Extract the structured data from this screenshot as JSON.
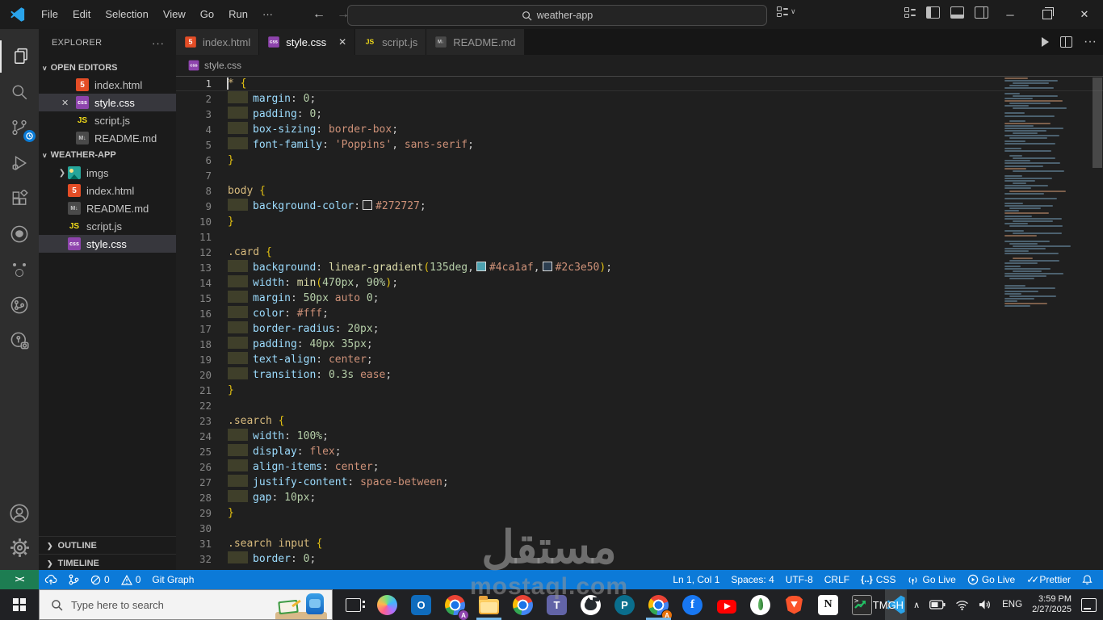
{
  "titlebar": {
    "menus": [
      "File",
      "Edit",
      "Selection",
      "View",
      "Go",
      "Run",
      "···"
    ],
    "search_value": "weather-app",
    "window": {
      "minimize": "─",
      "close": "✕"
    }
  },
  "activitybar": {
    "icons": [
      "explorer",
      "search",
      "source-control",
      "run-debug",
      "extensions",
      "github",
      "extension-face",
      "git-graph",
      "git-history",
      "account",
      "settings"
    ],
    "scm_badge": "clock"
  },
  "explorer": {
    "title": "EXPLORER",
    "actions": "···",
    "open_editors": {
      "label": "OPEN EDITORS",
      "items": [
        {
          "name": "index.html",
          "icon": "html"
        },
        {
          "name": "style.css",
          "icon": "css",
          "active": true
        },
        {
          "name": "script.js",
          "icon": "js"
        },
        {
          "name": "README.md",
          "icon": "md"
        }
      ]
    },
    "project": {
      "label": "WEATHER-APP",
      "items": [
        {
          "name": "imgs",
          "icon": "img",
          "folder": true
        },
        {
          "name": "index.html",
          "icon": "html"
        },
        {
          "name": "README.md",
          "icon": "md"
        },
        {
          "name": "script.js",
          "icon": "js"
        },
        {
          "name": "style.css",
          "icon": "css",
          "selected": true
        }
      ]
    },
    "panels": [
      "OUTLINE",
      "TIMELINE"
    ]
  },
  "file_icons": {
    "html": "5",
    "css": "css",
    "js": "JS",
    "md": "M↓",
    "img": ""
  },
  "tabs": [
    {
      "label": "index.html",
      "icon": "html"
    },
    {
      "label": "style.css",
      "icon": "css",
      "active": true,
      "close": "✕"
    },
    {
      "label": "script.js",
      "icon": "js"
    },
    {
      "label": "README.md",
      "icon": "md"
    }
  ],
  "breadcrumb": {
    "file": "style.css"
  },
  "code": {
    "lines": [
      {
        "n": 1,
        "cur": true,
        "tokens": [
          [
            "sel",
            "*"
          ],
          [
            "pl",
            " "
          ],
          [
            "brc",
            "{"
          ]
        ]
      },
      {
        "n": 2,
        "ind": true,
        "tokens": [
          [
            "prop",
            "margin"
          ],
          [
            "pl",
            ": "
          ],
          [
            "num",
            "0"
          ],
          [
            "pl",
            ";"
          ]
        ]
      },
      {
        "n": 3,
        "ind": true,
        "tokens": [
          [
            "prop",
            "padding"
          ],
          [
            "pl",
            ": "
          ],
          [
            "num",
            "0"
          ],
          [
            "pl",
            ";"
          ]
        ]
      },
      {
        "n": 4,
        "ind": true,
        "tokens": [
          [
            "prop",
            "box-sizing"
          ],
          [
            "pl",
            ": "
          ],
          [
            "val",
            "border-box"
          ],
          [
            "pl",
            ";"
          ]
        ]
      },
      {
        "n": 5,
        "ind": true,
        "tokens": [
          [
            "prop",
            "font-family"
          ],
          [
            "pl",
            ": "
          ],
          [
            "str",
            "'Poppins'"
          ],
          [
            "pl",
            ", "
          ],
          [
            "val",
            "sans-serif"
          ],
          [
            "pl",
            ";"
          ]
        ]
      },
      {
        "n": 6,
        "tokens": [
          [
            "brc",
            "}"
          ]
        ]
      },
      {
        "n": 7,
        "tokens": []
      },
      {
        "n": 8,
        "tokens": [
          [
            "sel",
            "body"
          ],
          [
            "pl",
            " "
          ],
          [
            "brc",
            "{"
          ]
        ]
      },
      {
        "n": 9,
        "ind": true,
        "tokens": [
          [
            "prop",
            "background-color"
          ],
          [
            "pl",
            ":"
          ],
          [
            "sw",
            "#272727"
          ],
          [
            "hex",
            "#272727"
          ],
          [
            "pl",
            ";"
          ]
        ]
      },
      {
        "n": 10,
        "tokens": [
          [
            "brc",
            "}"
          ]
        ]
      },
      {
        "n": 11,
        "tokens": []
      },
      {
        "n": 12,
        "tokens": [
          [
            "sel",
            ".card"
          ],
          [
            "pl",
            " "
          ],
          [
            "brc",
            "{"
          ]
        ]
      },
      {
        "n": 13,
        "ind": true,
        "tokens": [
          [
            "prop",
            "background"
          ],
          [
            "pl",
            ": "
          ],
          [
            "fn",
            "linear-gradient"
          ],
          [
            "brc",
            "("
          ],
          [
            "num",
            "135deg"
          ],
          [
            "pl",
            ","
          ],
          [
            "sw",
            "#4ca1af"
          ],
          [
            "hex",
            "#4ca1af"
          ],
          [
            "pl",
            ","
          ],
          [
            "sw",
            "#2c3e50"
          ],
          [
            "hex",
            "#2c3e50"
          ],
          [
            "brc",
            ")"
          ],
          [
            "pl",
            ";"
          ]
        ]
      },
      {
        "n": 14,
        "ind": true,
        "tokens": [
          [
            "prop",
            "width"
          ],
          [
            "pl",
            ": "
          ],
          [
            "fn",
            "min"
          ],
          [
            "brc",
            "("
          ],
          [
            "num",
            "470px"
          ],
          [
            "pl",
            ", "
          ],
          [
            "num",
            "90%"
          ],
          [
            "brc",
            ")"
          ],
          [
            "pl",
            ";"
          ]
        ]
      },
      {
        "n": 15,
        "ind": true,
        "tokens": [
          [
            "prop",
            "margin"
          ],
          [
            "pl",
            ": "
          ],
          [
            "num",
            "50px"
          ],
          [
            "pl",
            " "
          ],
          [
            "val",
            "auto"
          ],
          [
            "pl",
            " "
          ],
          [
            "num",
            "0"
          ],
          [
            "pl",
            ";"
          ]
        ]
      },
      {
        "n": 16,
        "ind": true,
        "tokens": [
          [
            "prop",
            "color"
          ],
          [
            "pl",
            ": "
          ],
          [
            "hex",
            "#fff"
          ],
          [
            "pl",
            ";"
          ]
        ]
      },
      {
        "n": 17,
        "ind": true,
        "tokens": [
          [
            "prop",
            "border-radius"
          ],
          [
            "pl",
            ": "
          ],
          [
            "num",
            "20px"
          ],
          [
            "pl",
            ";"
          ]
        ]
      },
      {
        "n": 18,
        "ind": true,
        "tokens": [
          [
            "prop",
            "padding"
          ],
          [
            "pl",
            ": "
          ],
          [
            "num",
            "40px"
          ],
          [
            "pl",
            " "
          ],
          [
            "num",
            "35px"
          ],
          [
            "pl",
            ";"
          ]
        ]
      },
      {
        "n": 19,
        "ind": true,
        "tokens": [
          [
            "prop",
            "text-align"
          ],
          [
            "pl",
            ": "
          ],
          [
            "val",
            "center"
          ],
          [
            "pl",
            ";"
          ]
        ]
      },
      {
        "n": 20,
        "ind": true,
        "tokens": [
          [
            "prop",
            "transition"
          ],
          [
            "pl",
            ": "
          ],
          [
            "num",
            "0.3s"
          ],
          [
            "pl",
            " "
          ],
          [
            "val",
            "ease"
          ],
          [
            "pl",
            ";"
          ]
        ]
      },
      {
        "n": 21,
        "tokens": [
          [
            "brc",
            "}"
          ]
        ]
      },
      {
        "n": 22,
        "tokens": []
      },
      {
        "n": 23,
        "tokens": [
          [
            "sel",
            ".search"
          ],
          [
            "pl",
            " "
          ],
          [
            "brc",
            "{"
          ]
        ]
      },
      {
        "n": 24,
        "ind": true,
        "tokens": [
          [
            "prop",
            "width"
          ],
          [
            "pl",
            ": "
          ],
          [
            "num",
            "100%"
          ],
          [
            "pl",
            ";"
          ]
        ]
      },
      {
        "n": 25,
        "ind": true,
        "tokens": [
          [
            "prop",
            "display"
          ],
          [
            "pl",
            ": "
          ],
          [
            "val",
            "flex"
          ],
          [
            "pl",
            ";"
          ]
        ]
      },
      {
        "n": 26,
        "ind": true,
        "tokens": [
          [
            "prop",
            "align-items"
          ],
          [
            "pl",
            ": "
          ],
          [
            "val",
            "center"
          ],
          [
            "pl",
            ";"
          ]
        ]
      },
      {
        "n": 27,
        "ind": true,
        "tokens": [
          [
            "prop",
            "justify-content"
          ],
          [
            "pl",
            ": "
          ],
          [
            "val",
            "space-between"
          ],
          [
            "pl",
            ";"
          ]
        ]
      },
      {
        "n": 28,
        "ind": true,
        "tokens": [
          [
            "prop",
            "gap"
          ],
          [
            "pl",
            ": "
          ],
          [
            "num",
            "10px"
          ],
          [
            "pl",
            ";"
          ]
        ]
      },
      {
        "n": 29,
        "tokens": [
          [
            "brc",
            "}"
          ]
        ]
      },
      {
        "n": 30,
        "tokens": []
      },
      {
        "n": 31,
        "tokens": [
          [
            "sel",
            ".search"
          ],
          [
            "pl",
            " "
          ],
          [
            "sel",
            "input"
          ],
          [
            "pl",
            " "
          ],
          [
            "brc",
            "{"
          ]
        ]
      },
      {
        "n": 32,
        "ind": true,
        "tokens": [
          [
            "prop",
            "border"
          ],
          [
            "pl",
            ": "
          ],
          [
            "num",
            "0"
          ],
          [
            "pl",
            ";"
          ]
        ]
      }
    ]
  },
  "statusbar": {
    "remote": "><",
    "left": [
      {
        "icon": "cloud-upload"
      },
      {
        "icon": "git-graph-ico"
      },
      {
        "icon": "error-ico",
        "label": "0"
      },
      {
        "icon": "warn-ico",
        "label": "0"
      },
      {
        "label": "Git Graph"
      }
    ],
    "right": [
      {
        "label": "Ln 1, Col 1"
      },
      {
        "label": "Spaces: 4"
      },
      {
        "label": "UTF-8"
      },
      {
        "label": "CRLF"
      },
      {
        "icon": "braces",
        "label": "CSS"
      },
      {
        "icon": "broadcast",
        "label": "Go Live"
      },
      {
        "icon": "circle-play",
        "label": "Go Live"
      },
      {
        "icon": "double-check",
        "label": "Prettier"
      },
      {
        "icon": "bell"
      }
    ]
  },
  "taskbar": {
    "search_placeholder": "Type here to search",
    "apps": [
      {
        "kind": "task-view"
      },
      {
        "kind": "copilot"
      },
      {
        "kind": "outlook",
        "letter": "O"
      },
      {
        "kind": "chrome",
        "badge": "A",
        "badge_color": "#8e44ad"
      },
      {
        "kind": "file-explorer",
        "active": true
      },
      {
        "kind": "chrome"
      },
      {
        "kind": "teams",
        "letter": "T"
      },
      {
        "kind": "github"
      },
      {
        "kind": "packet-tracer",
        "letter": "P"
      },
      {
        "kind": "chrome",
        "badge": "A",
        "badge_color": "#e8710a",
        "active": true
      },
      {
        "kind": "facebook",
        "letter": "f"
      },
      {
        "kind": "youtube"
      },
      {
        "kind": "mongodb"
      },
      {
        "kind": "brave"
      },
      {
        "kind": "notion",
        "letter": "N"
      },
      {
        "kind": "terminal",
        "letter": ">_"
      },
      {
        "kind": "vscode",
        "focused": true
      }
    ],
    "tray": {
      "app": "TMGH",
      "chevron": "∧",
      "lang": "ENG",
      "time": "3:59 PM",
      "date": "2/27/2025"
    }
  },
  "watermark": {
    "arabic": "مستقل",
    "latin": "mostaql.com"
  }
}
